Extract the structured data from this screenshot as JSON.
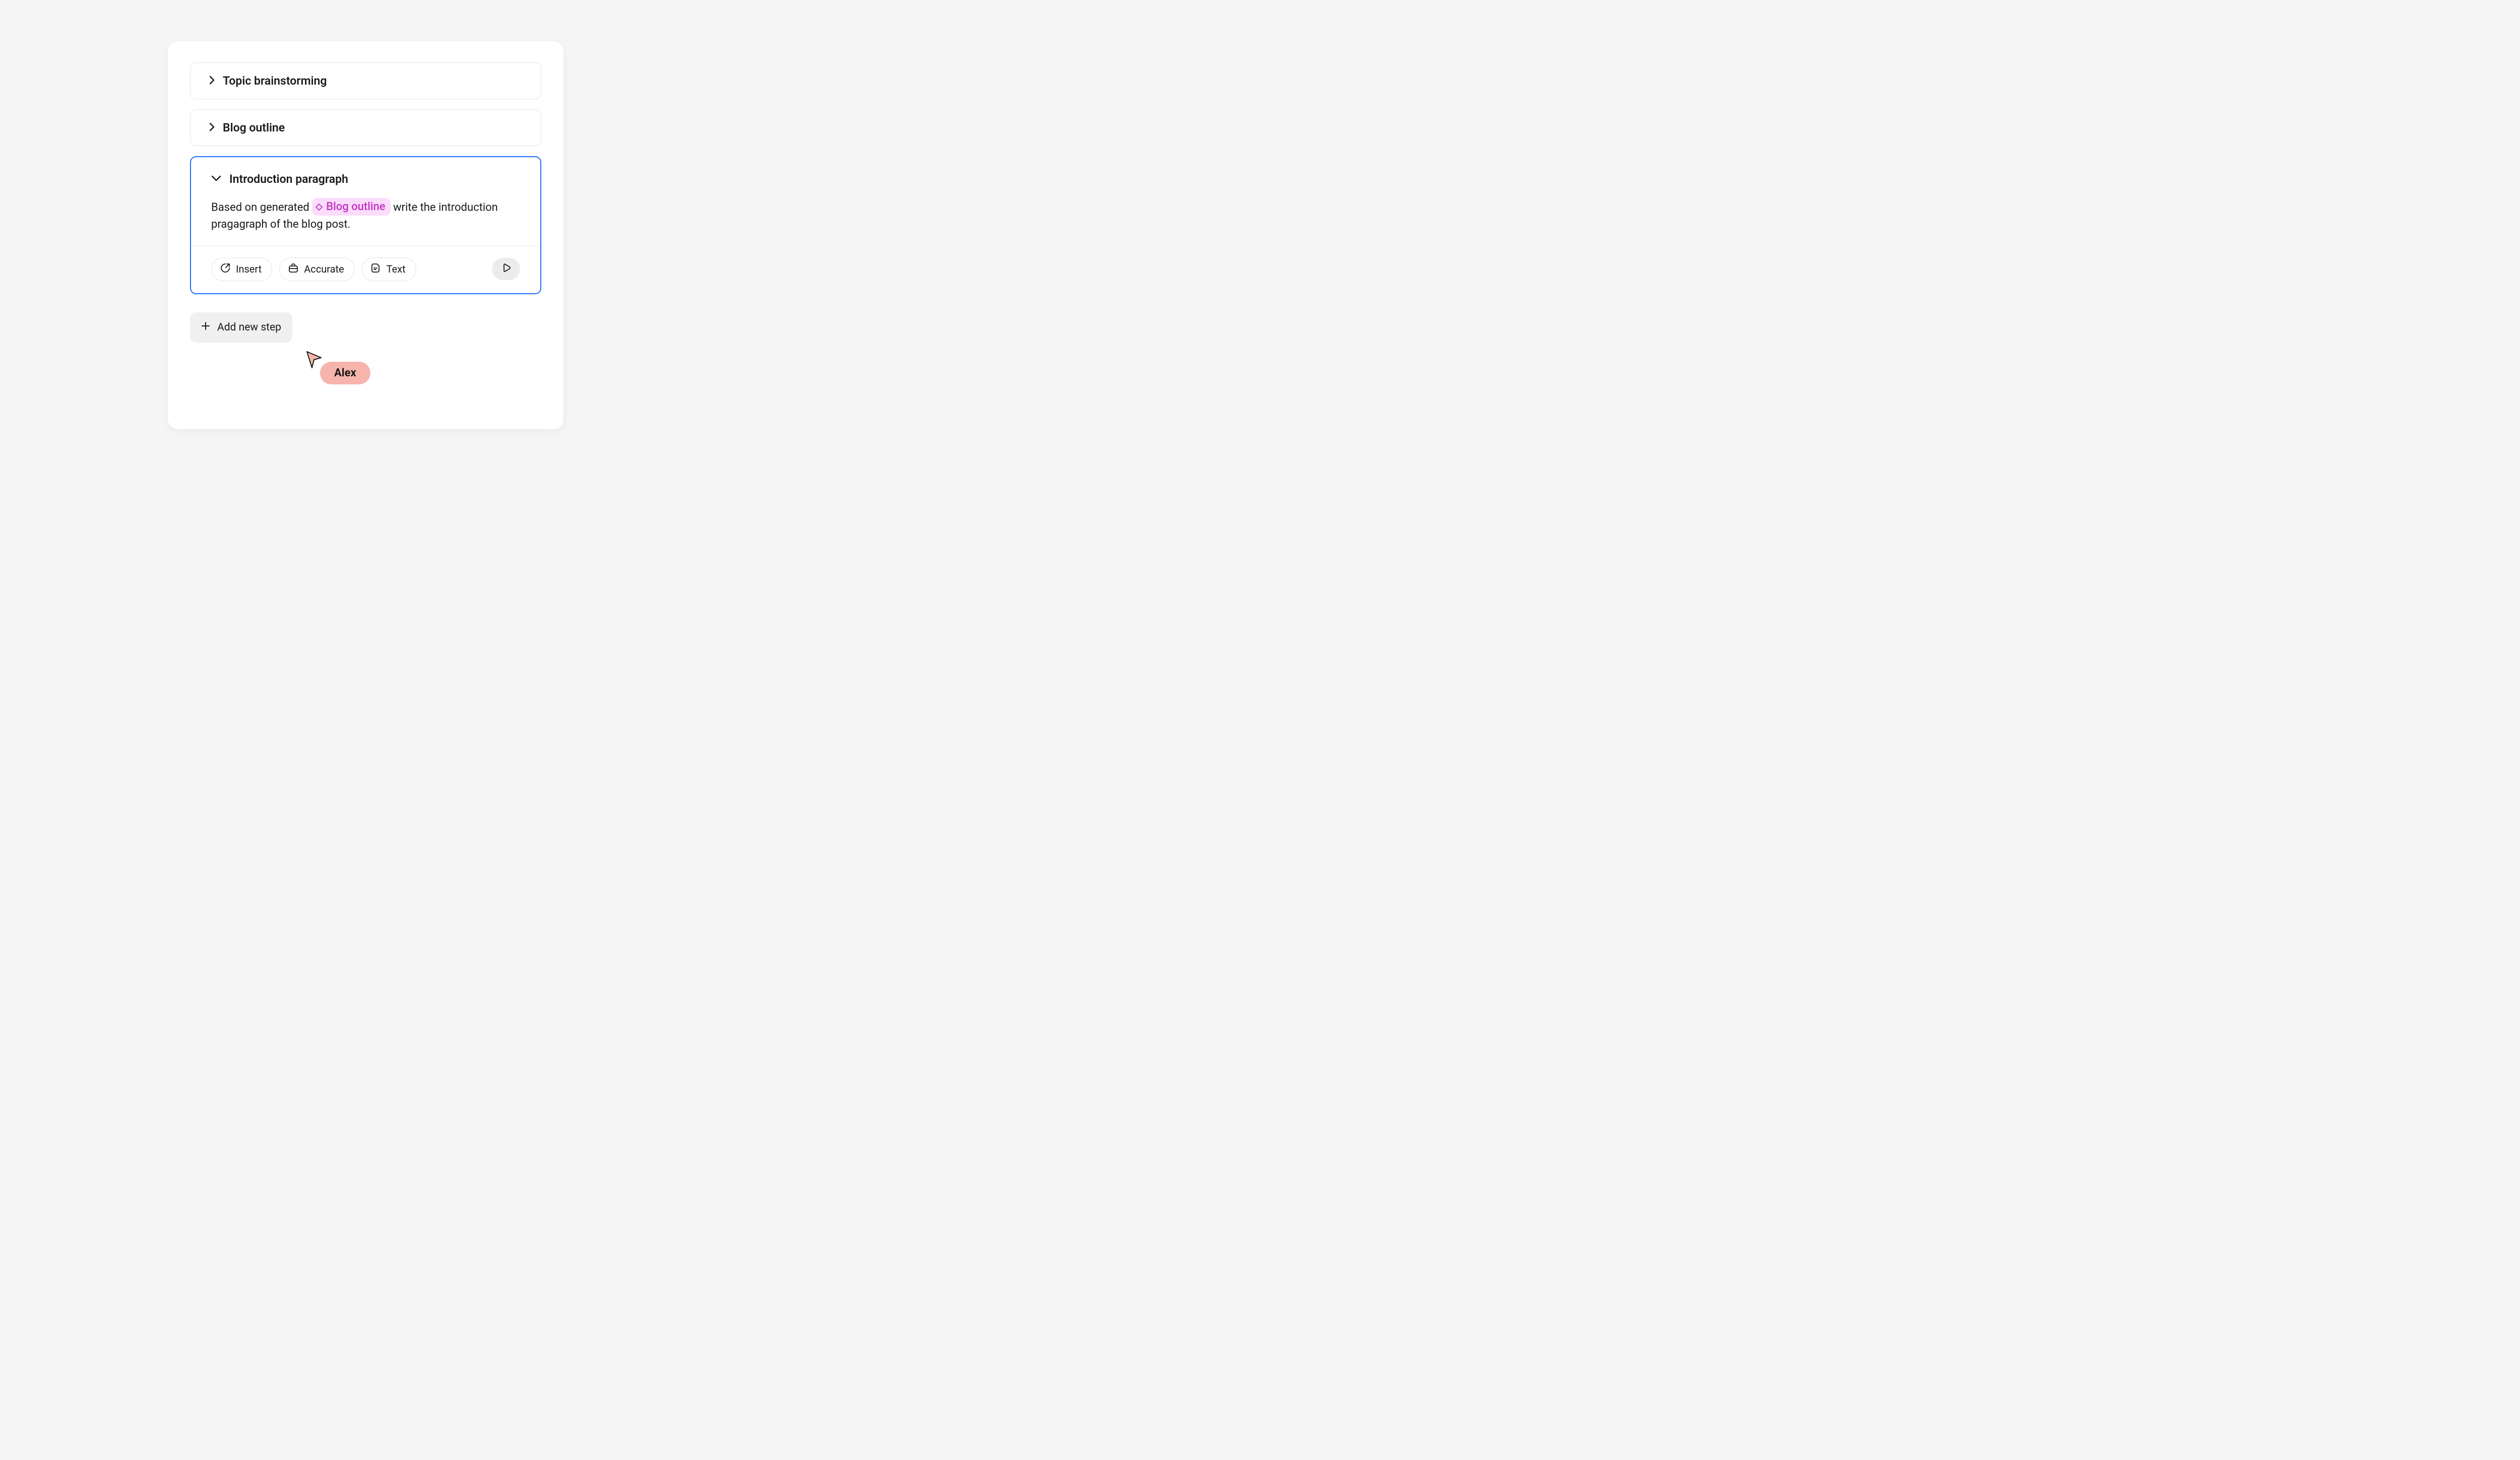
{
  "steps": {
    "topic": {
      "title": "Topic brainstorming"
    },
    "outline": {
      "title": "Blog outline"
    },
    "intro": {
      "title": "Introduction paragraph",
      "body_pre": "Based on generated ",
      "ref_label": "Blog outline",
      "body_post": " write the introduction pragagraph of the blog post."
    }
  },
  "toolbar": {
    "insert": "Insert",
    "accurate": "Accurate",
    "text": "Text"
  },
  "add_step_label": "Add new step",
  "cursor_user": "Alex"
}
